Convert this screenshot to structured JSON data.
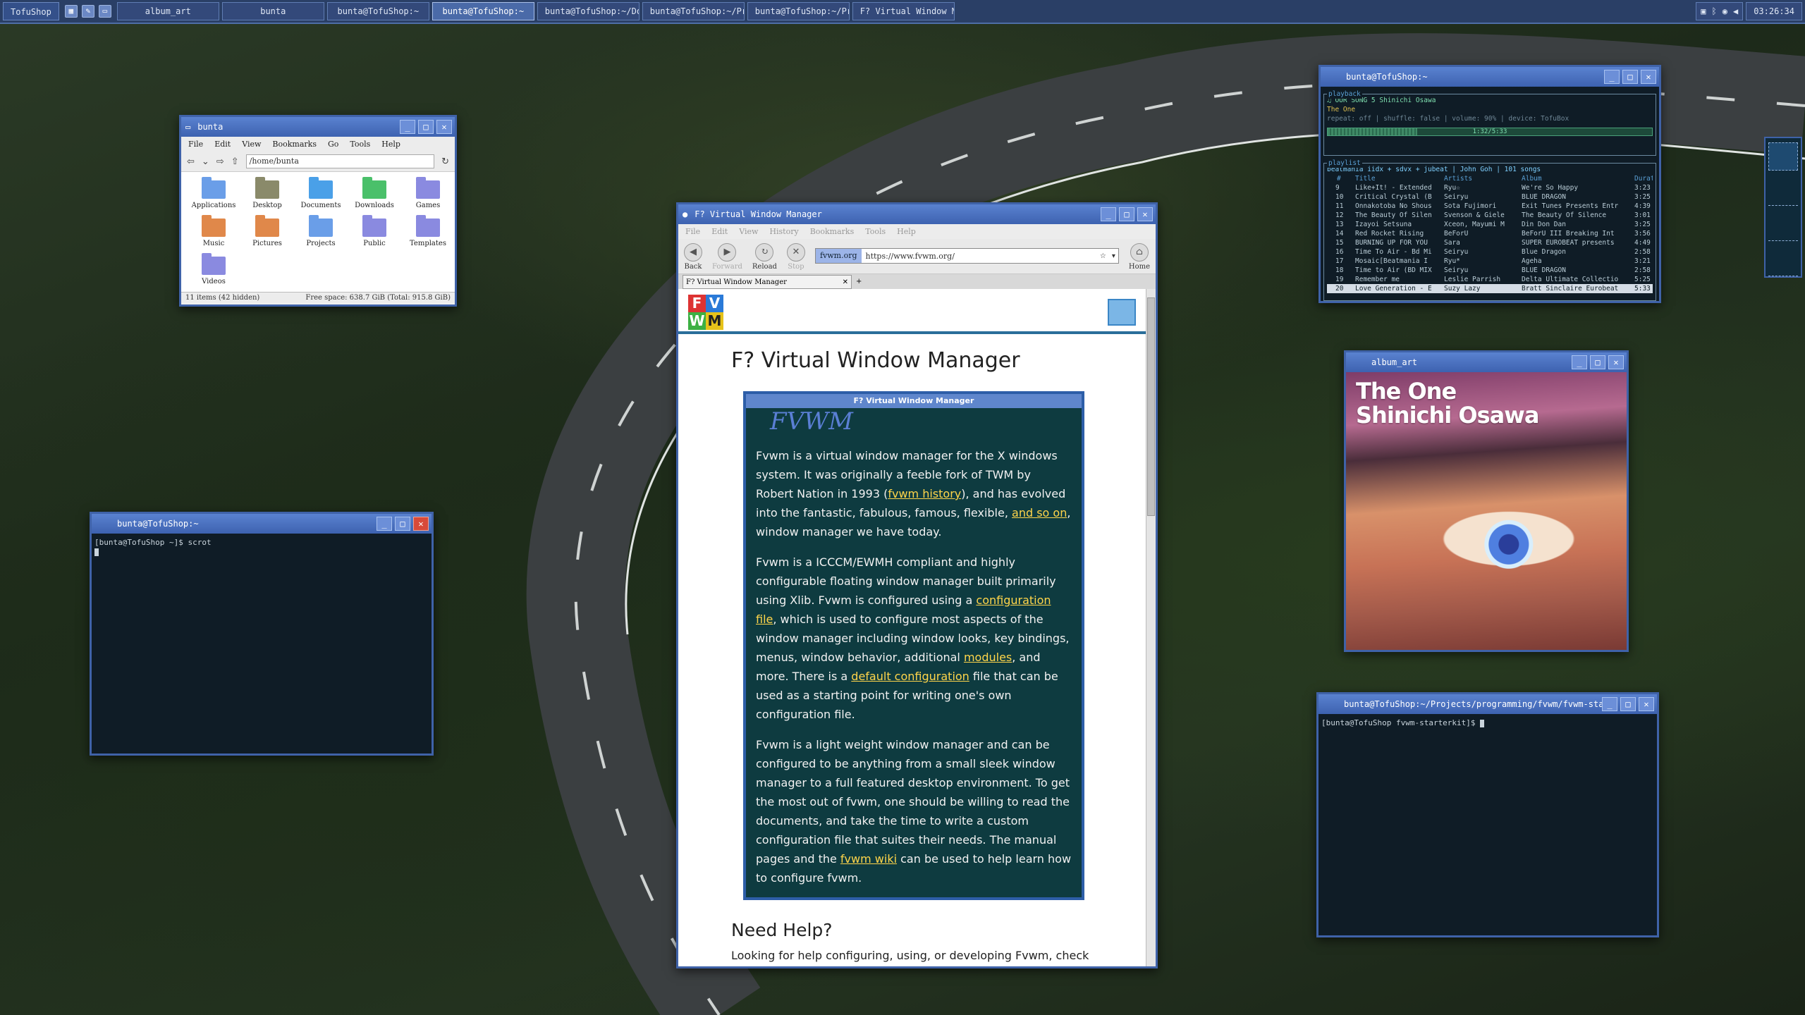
{
  "taskbar": {
    "start": "TofuShop",
    "tasks": [
      {
        "label": "album_art"
      },
      {
        "label": "bunta"
      },
      {
        "label": "bunta@TofuShop:~"
      },
      {
        "label": "bunta@TofuShop:~"
      },
      {
        "label": "bunta@TofuShop:~/Docu"
      },
      {
        "label": "bunta@TofuShop:~/Proj"
      },
      {
        "label": "bunta@TofuShop:~/Proj"
      },
      {
        "label": "F? Virtual Window Mar"
      }
    ],
    "clock": "03:26:34"
  },
  "file_manager": {
    "title": "bunta",
    "menu": [
      "File",
      "Edit",
      "View",
      "Bookmarks",
      "Go",
      "Tools",
      "Help"
    ],
    "path": "/home/bunta",
    "items": [
      {
        "label": "Applications",
        "color": "#6a9ee8"
      },
      {
        "label": "Desktop",
        "color": "#8a8a6a"
      },
      {
        "label": "Documents",
        "color": "#4aa0e8"
      },
      {
        "label": "Downloads",
        "color": "#4ac06a"
      },
      {
        "label": "Games",
        "color": "#8a8ae0"
      },
      {
        "label": "Music",
        "color": "#e0884a"
      },
      {
        "label": "Pictures",
        "color": "#e0884a"
      },
      {
        "label": "Projects",
        "color": "#6a9ee8"
      },
      {
        "label": "Public",
        "color": "#8a8ae0"
      },
      {
        "label": "Templates",
        "color": "#8a8ae0"
      },
      {
        "label": "Videos",
        "color": "#8a8ae0"
      }
    ],
    "status_left": "11 items (42 hidden)",
    "status_right": "Free space: 638.7 GiB (Total: 915.8 GiB)"
  },
  "terminal_left": {
    "title": "bunta@TofuShop:~",
    "prompt": "[bunta@TofuShop ~]$ scrot"
  },
  "browser": {
    "title": "F? Virtual Window Manager",
    "menu": [
      "File",
      "Edit",
      "View",
      "History",
      "Bookmarks",
      "Tools",
      "Help"
    ],
    "buttons": {
      "back": "Back",
      "forward": "Forward",
      "reload": "Reload",
      "stop": "Stop",
      "home": "Home"
    },
    "host": "fvwm.org",
    "url": "https://www.fvwm.org/",
    "tab": "F? Virtual Window Manager",
    "page": {
      "heading": "F? Virtual Window Manager",
      "box_title": "F? Virtual Window Manager",
      "logo_text": "FVWM",
      "p1_a": "Fvwm is a virtual window manager for the X windows system. It was originally a feeble fork of TWM by Robert Nation in 1993 (",
      "p1_link1": "fvwm history",
      "p1_b": "), and has evolved into the fantastic, fabulous, famous, flexible, ",
      "p1_link2": "and so on",
      "p1_c": ", window manager we have today.",
      "p2_a": "Fvwm is a ICCCM/EWMH compliant and highly configurable floating window manager built primarily using Xlib. Fvwm is configured using a ",
      "p2_link1": "configuration file",
      "p2_b": ", which is used to configure most aspects of the window manager including window looks, key bindings, menus, window behavior, additional ",
      "p2_link2": "modules",
      "p2_c": ", and more. There is a ",
      "p2_link3": "default configuration",
      "p2_d": " file that can be used as a starting point for writing one's own configuration file.",
      "p3_a": "Fvwm is a light weight window manager and can be configured to be anything from a small sleek window manager to a full featured desktop environment. To get the most out of fvwm, one should be willing to read the documents, and take the time to write a custom configuration file that suites their needs. The manual pages and the ",
      "p3_link": "fvwm wiki",
      "p3_b": " can be used to help learn how to configure fvwm.",
      "help_heading": "Need Help?",
      "help_text": "Looking for help configuring, using, or developing Fvwm, check"
    }
  },
  "music": {
    "title": "bunta@TofuShop:~",
    "playback_label": "playback",
    "now_playing": "OUR SONG 5 Shinichi Osawa",
    "album": "The One",
    "status": "repeat: off | shuffle: false | volume: 90% | device: TofuBox",
    "progress_text": "1:32/5:33",
    "progress": 0.277,
    "playlist_label": "playlist",
    "playlist_title": "beatmania iidx + sdvx + jubeat | John Goh | 101 songs",
    "columns": [
      "#",
      "Title",
      "Artists",
      "Album",
      "Durat"
    ],
    "rows": [
      [
        "9",
        "Like+It! - Extended",
        "Ryu☆",
        "We're So Happy",
        "3:23"
      ],
      [
        "10",
        "Critical Crystal (B",
        "Seiryu",
        "BLUE DRAGON",
        "3:25"
      ],
      [
        "11",
        "Onnakotoba No Shous",
        "Sota Fujimori",
        "Exit Tunes Presents Entr",
        "4:39"
      ],
      [
        "12",
        "The Beauty Of Silen",
        "Svenson & Giele",
        "The Beauty Of Silence",
        "3:01"
      ],
      [
        "13",
        "Izayoi Setsuna",
        "Xceon, Mayumi M",
        "Din Don Dan",
        "3:25"
      ],
      [
        "14",
        "Red Rocket Rising",
        "BeForU",
        "BeForU III Breaking Int",
        "3:56"
      ],
      [
        "15",
        "BURNING UP FOR YOU",
        "Sara",
        "SUPER EUROBEAT presents",
        "4:49"
      ],
      [
        "16",
        "Time To Air - Bd Mi",
        "Seiryu",
        "Blue Dragon",
        "2:58"
      ],
      [
        "17",
        "Mosaic[Beatmania I",
        "Ryu*",
        "Ageha",
        "3:21"
      ],
      [
        "18",
        "Time to Air (BD MIX",
        "Seiryu",
        "BLUE DRAGON",
        "2:58"
      ],
      [
        "19",
        "Remember me",
        "Leslie Parrish",
        "Delta Ultimate Collectio",
        "5:25"
      ],
      [
        "20",
        "Love Generation - E",
        "Suzy Lazy",
        "Bratt Sinclaire Eurobeat",
        "5:33"
      ]
    ]
  },
  "album_art": {
    "title": "album_art",
    "line1": "The One",
    "line2": "Shinichi Osawa"
  },
  "terminal_right": {
    "title": "bunta@TofuShop:~/Projects/programming/fvwm/fvwm-starterkit",
    "prompt": "[bunta@TofuShop fvwm-starterkit]$ "
  }
}
